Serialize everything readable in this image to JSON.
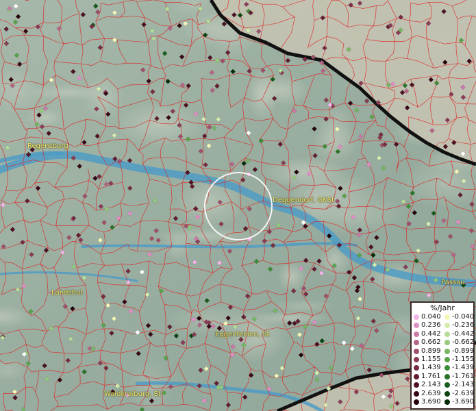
{
  "cities": [
    {
      "key": "regensburg",
      "name": "Regensburg"
    },
    {
      "key": "deggendorf",
      "name": "Deggendorf, GKSt"
    },
    {
      "key": "landshut",
      "name": "Landshut"
    },
    {
      "key": "passau",
      "name": "Passau"
    },
    {
      "key": "eggenfelden",
      "name": "Eggenfelden, St"
    },
    {
      "key": "waldkraiburg",
      "name": "Waldkraiburg, St"
    }
  ],
  "legend": {
    "title": "%/Jahr",
    "positive": [
      {
        "value": "0.040",
        "color": "#f2b3e6"
      },
      {
        "value": "0.236",
        "color": "#e08fc5"
      },
      {
        "value": "0.442",
        "color": "#c97aa6"
      },
      {
        "value": "0.662",
        "color": "#b46586"
      },
      {
        "value": "0.899",
        "color": "#9f516c"
      },
      {
        "value": "1.155",
        "color": "#8a3d55"
      },
      {
        "value": "1.439",
        "color": "#772c42"
      },
      {
        "value": "1.761",
        "color": "#621d31"
      },
      {
        "value": "2.143",
        "color": "#4d1123"
      },
      {
        "value": "2.639",
        "color": "#380817"
      },
      {
        "value": "3.690",
        "color": "#22020b"
      }
    ],
    "negative": [
      {
        "value": "-0.040",
        "color": "#f4f7b8"
      },
      {
        "value": "-0.236",
        "color": "#d6ecb0"
      },
      {
        "value": "-0.442",
        "color": "#b5dc98"
      },
      {
        "value": "-0.662",
        "color": "#95c97d"
      },
      {
        "value": "-0.899",
        "color": "#76b563"
      },
      {
        "value": "-1.155",
        "color": "#5aa24b"
      },
      {
        "value": "-1.439",
        "color": "#3f8c38"
      },
      {
        "value": "-1.761",
        "color": "#2a7428"
      },
      {
        "value": "-2.143",
        "color": "#195c1b"
      },
      {
        "value": "-2.639",
        "color": "#0d4511"
      },
      {
        "value": "-3.690",
        "color": "#042d08"
      }
    ]
  },
  "colors": {
    "water": "#4f9cc4",
    "border": "#e02020",
    "country_border": "#111111",
    "label": "#f3e96a"
  }
}
